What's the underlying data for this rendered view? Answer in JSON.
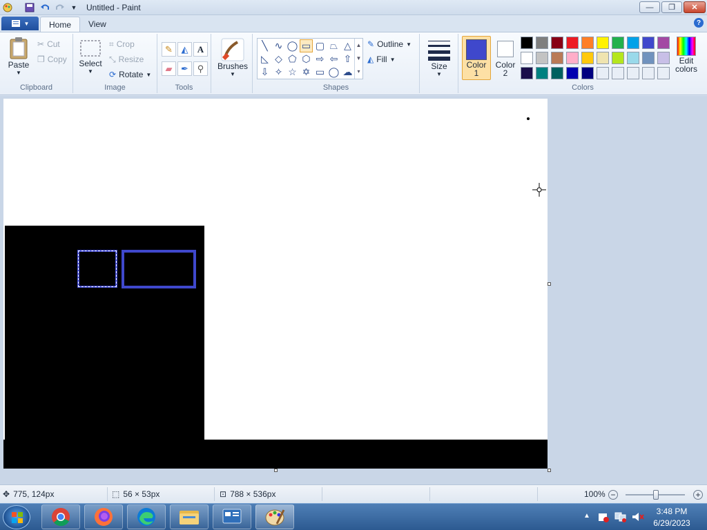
{
  "window": {
    "title": "Untitled - Paint"
  },
  "tabs": [
    {
      "label": "Home"
    },
    {
      "label": "View"
    }
  ],
  "clipboard": {
    "paste": "Paste",
    "cut": "Cut",
    "copy": "Copy",
    "label": "Clipboard"
  },
  "image": {
    "select": "Select",
    "crop": "Crop",
    "resize": "Resize",
    "rotate": "Rotate",
    "label": "Image"
  },
  "tools": {
    "label": "Tools"
  },
  "brushes": {
    "label": "Brushes"
  },
  "shapes": {
    "outline": "Outline",
    "fill": "Fill",
    "label": "Shapes"
  },
  "size": {
    "label": "Size"
  },
  "colors": {
    "color1_label": "Color\n1",
    "color1_line1": "Color",
    "color1_line2": "1",
    "color2_line1": "Color",
    "color2_line2": "2",
    "edit_line1": "Edit",
    "edit_line2": "colors",
    "label": "Colors",
    "color1": "#3f48cc",
    "color2": "#ffffff",
    "palette": [
      "#000000",
      "#7f7f7f",
      "#880015",
      "#ed1c24",
      "#ff7f27",
      "#fff200",
      "#22b14c",
      "#00a2e8",
      "#3f48cc",
      "#a349a4",
      "#ffffff",
      "#c3c3c3",
      "#b97a57",
      "#ffaec9",
      "#ffc90e",
      "#efe4b0",
      "#b5e61d",
      "#99d9ea",
      "#7092be",
      "#c8bfe7",
      "#1a0f4a",
      "#008080",
      "#006060",
      "#0000b0",
      "#000080",
      "#e8eef6",
      "#e8eef6",
      "#e8eef6",
      "#e8eef6",
      "#e8eef6"
    ]
  },
  "status": {
    "cursor_pos": "775, 124px",
    "selection_size": "56 × 53px",
    "image_size": "788 × 536px",
    "zoom": "100%"
  },
  "tray": {
    "time": "3:48 PM",
    "date": "6/29/2023"
  }
}
